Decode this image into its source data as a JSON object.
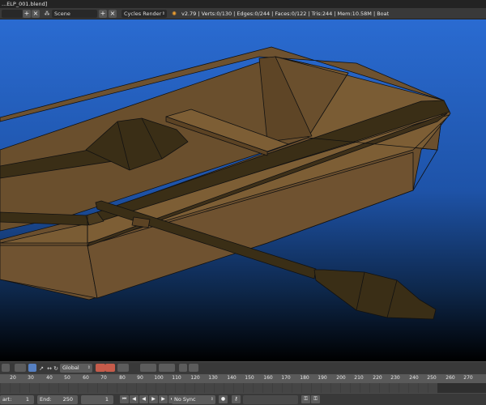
{
  "window": {
    "title": "...ELP_001.blend]"
  },
  "info_header": {
    "layout_name": "",
    "scene_name": "Scene",
    "render_engine": "Cycles Render",
    "stats": "v2.79 | Verts:0/130 | Edges:0/244 | Faces:0/122 | Tris:244 | Mem:10.58M | Boat"
  },
  "view3d_header": {
    "orientation": "Global"
  },
  "timeline": {
    "ruler_ticks": [
      "20",
      "30",
      "40",
      "50",
      "60",
      "70",
      "80",
      "90",
      "100",
      "110",
      "120",
      "130",
      "140",
      "150",
      "160",
      "170",
      "180",
      "190",
      "200",
      "210",
      "220",
      "230",
      "240",
      "250",
      "260",
      "270"
    ],
    "start_label": "art:",
    "start_value": "1",
    "end_label": "End:",
    "end_value": "250",
    "current_frame": "1",
    "sync_mode": "No Sync"
  },
  "colors": {
    "wood": "#6b4f2e",
    "wood_dark": "#3a2e16",
    "background_top": "#2a6bd1",
    "background_bottom": "#000000"
  }
}
